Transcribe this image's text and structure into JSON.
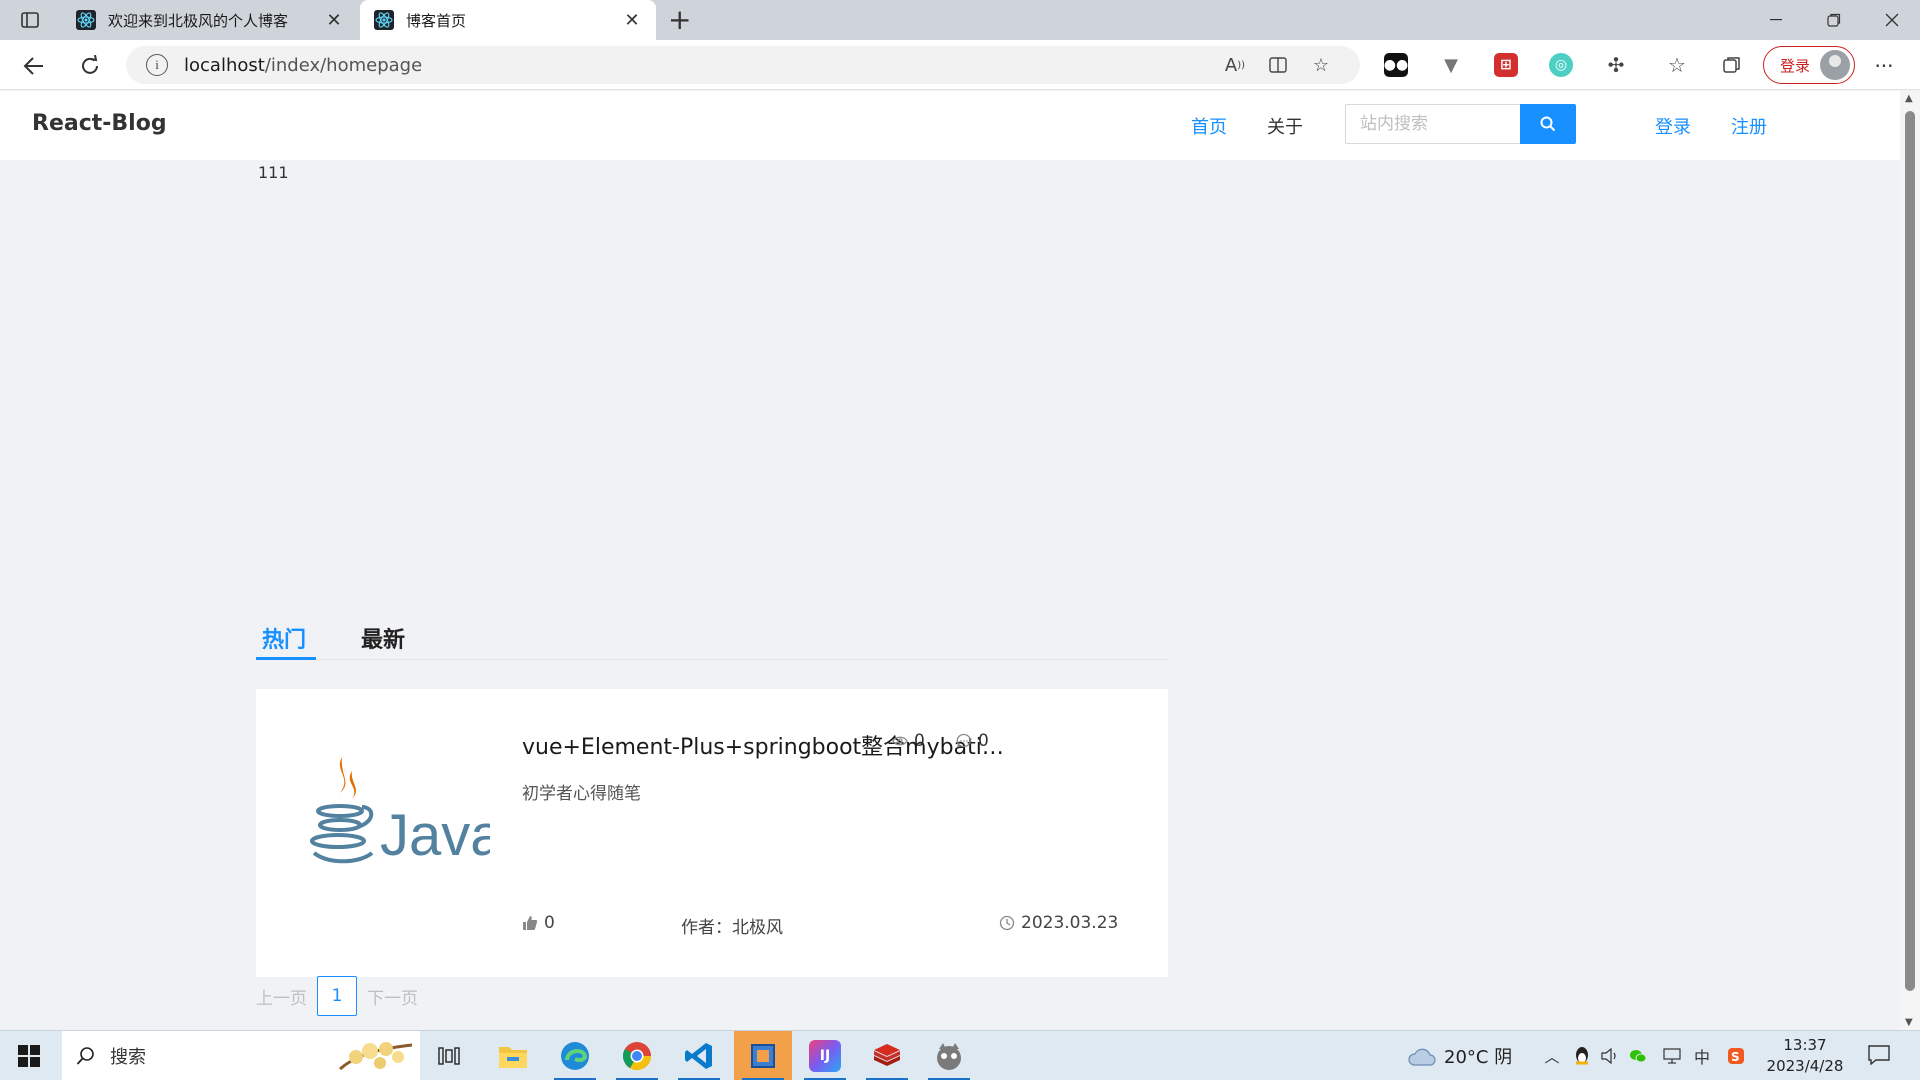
{
  "browser": {
    "tabs": [
      {
        "title": "欢迎来到北极风的个人博客",
        "active": false
      },
      {
        "title": "博客首页",
        "active": true
      }
    ],
    "url_host": "localhost",
    "url_path": "/index/homepage",
    "profile_login_label": "登录"
  },
  "site": {
    "logo": "React-Blog",
    "menu": {
      "home": "首页",
      "about": "关于",
      "login": "登录",
      "register": "注册"
    },
    "search_placeholder": "站内搜索",
    "accent_color": "#1890ff"
  },
  "content": {
    "placeholder_text": "111",
    "tabs": [
      {
        "label": "热门",
        "active": true
      },
      {
        "label": "最新",
        "active": false
      }
    ],
    "articles": [
      {
        "title": "vue+Element-Plus+springboot整合mybatis-...",
        "summary": "初学者心得随笔",
        "views": "0",
        "comments": "0",
        "likes": "0",
        "author": "作者：北极风",
        "date": "2023.03.23",
        "cover_icon": "java-logo"
      }
    ],
    "pagination": {
      "prev": "上一页",
      "current": "1",
      "next": "下一页"
    }
  },
  "taskbar": {
    "search_label": "搜索",
    "weather": "20°C 阴",
    "ime": "中",
    "time": "13:37",
    "date": "2023/4/28",
    "apps": [
      "task-view-icon",
      "file-explorer-icon",
      "edge-icon",
      "chrome-icon",
      "vscode-icon",
      "virtualbox-icon",
      "intellij-icon",
      "redis-icon",
      "navicat-icon"
    ]
  }
}
